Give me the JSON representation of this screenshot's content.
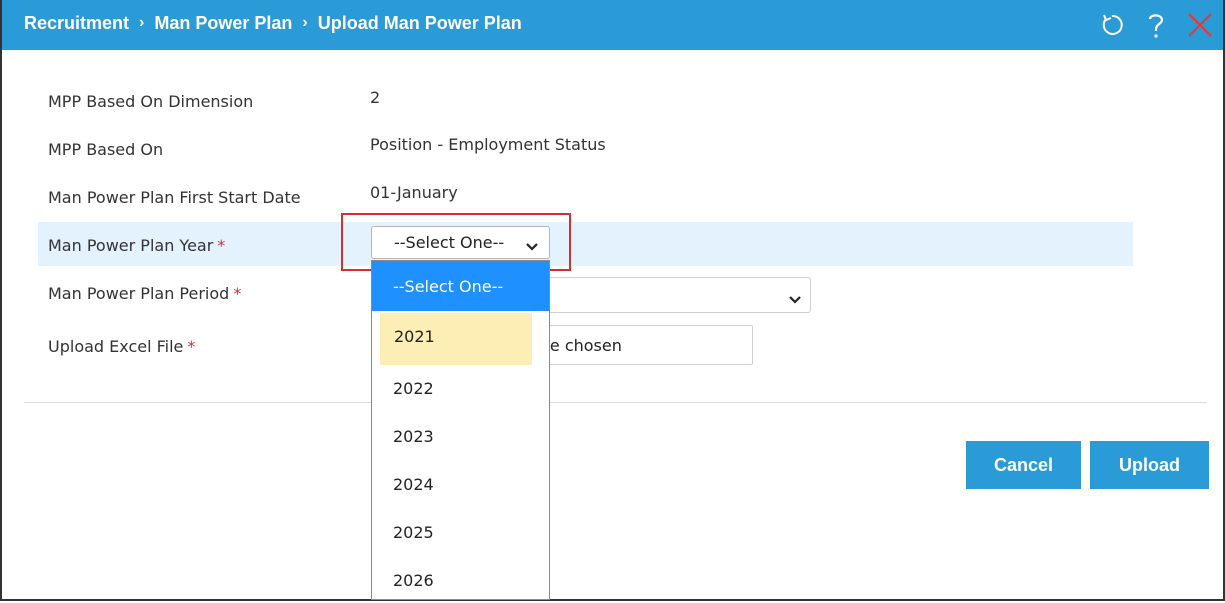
{
  "header": {
    "breadcrumb": [
      "Recruitment",
      "Man Power Plan",
      "Upload Man Power Plan"
    ],
    "icons": [
      "refresh-icon",
      "help-icon",
      "close-icon"
    ]
  },
  "form": {
    "dimension": {
      "label": "MPP Based On Dimension",
      "value": "2"
    },
    "based_on": {
      "label": "MPP Based On",
      "value": "Position - Employment Status"
    },
    "first_start_date": {
      "label": "Man Power Plan First Start Date",
      "value": "01-January"
    },
    "year": {
      "label": "Man Power Plan Year",
      "required": "*",
      "selected": "--Select One--"
    },
    "period": {
      "label": "Man Power Plan Period",
      "required": "*"
    },
    "upload": {
      "label": "Upload Excel File",
      "required": "*",
      "status_fragment": "ile chosen"
    }
  },
  "year_dropdown": {
    "options": [
      "--Select One--",
      "2021",
      "2022",
      "2023",
      "2024",
      "2025",
      "2026"
    ],
    "selected_index": 0,
    "hover_index": 1
  },
  "buttons": {
    "cancel": "Cancel",
    "upload": "Upload"
  },
  "colors": {
    "header_bg": "#2A9BD6",
    "highlight_row": "#E3F2FD",
    "required": "#D32F2F",
    "option_selected": "#1E90FF",
    "option_hover": "#FDEEB5",
    "close_icon": "#E53935"
  }
}
